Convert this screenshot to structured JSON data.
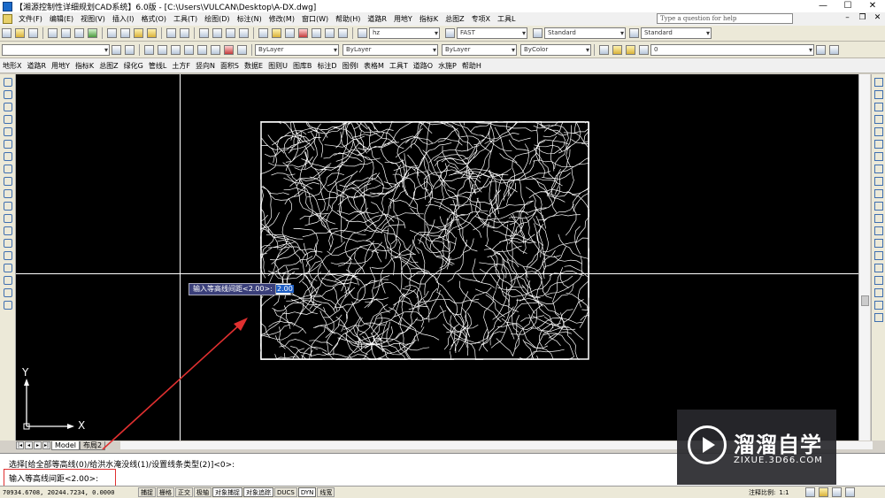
{
  "window": {
    "title": "【湘源控制性详细规划CAD系统】6.0版 - [C:\\Users\\VULCAN\\Desktop\\A-DX.dwg]",
    "minimize": "—",
    "maximize": "☐",
    "close": "✕"
  },
  "menu": {
    "items": [
      "文件(F)",
      "编辑(E)",
      "视图(V)",
      "插入(I)",
      "格式(O)",
      "工具(T)",
      "绘图(D)",
      "标注(N)",
      "修改(M)",
      "窗口(W)",
      "帮助(H)",
      "道路R",
      "用地Y",
      "指标K",
      "总图Z",
      "专项X",
      "工具L"
    ],
    "help_placeholder": "Type a question for help"
  },
  "toolbar1": {
    "layer_combo": "hz",
    "font_combo": "FAST",
    "style_combo1": "Standard",
    "style_combo2": "Standard"
  },
  "toolbar2": {
    "linetype1": "ByLayer",
    "linetype2": "ByLayer",
    "lineweight": "ByLayer",
    "plotstyle": "ByColor",
    "layer_state": "0"
  },
  "toolbar3": {
    "items": [
      "地形X",
      "道路R",
      "用地Y",
      "指标K",
      "总图Z",
      "绿化G",
      "管线L",
      "土方F",
      "竖向N",
      "面积S",
      "数据E",
      "图则U",
      "图库B",
      "标注D",
      "图例I",
      "表格M",
      "工具T",
      "道路O",
      "水施P",
      "帮助H"
    ]
  },
  "canvas": {
    "tooltip_label": "输入等高线间距<2.00>:",
    "tooltip_value": "2.00",
    "ucs_x": "X",
    "ucs_y": "Y"
  },
  "tabs": {
    "model": "Model",
    "layout": "布局2"
  },
  "command": {
    "line1": "选择[给全部等高线(0)/给洪水淹没线(1)/设置线条类型(2)]<0>:",
    "line2": "输入等高线间距<2.00>:"
  },
  "status": {
    "coords": "70934.6708, 20244.7234, 0.0000",
    "buttons": [
      "捕捉",
      "栅格",
      "正交",
      "极轴",
      "对象捕捉",
      "对象追踪",
      "DUCS",
      "DYN",
      "线宽"
    ],
    "annot_label": "注释比例:",
    "annot_scale": "1:1"
  },
  "watermark": {
    "brand": "溜溜自学",
    "url": "ZIXUE.3D66.COM"
  },
  "colors": {
    "canvas_bg": "#000000",
    "highlight": "#e03030",
    "tooltip_bg": "#3a3f7a"
  }
}
